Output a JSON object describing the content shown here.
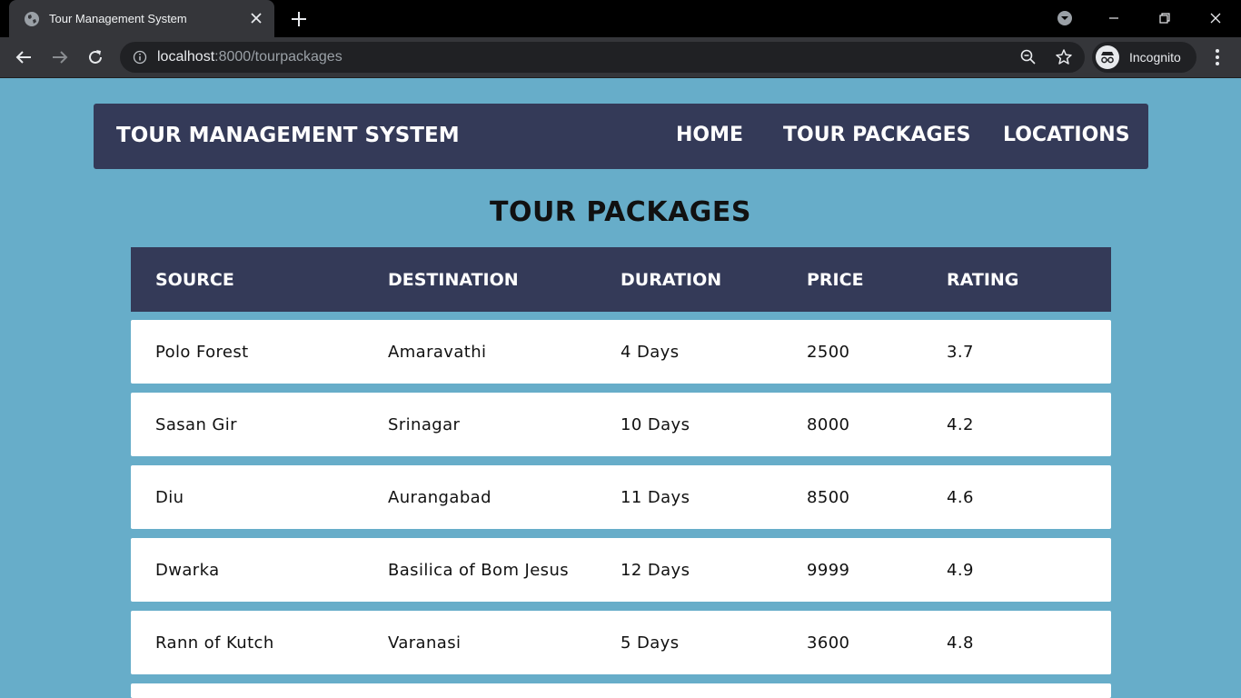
{
  "browser": {
    "tab_title": "Tour Management System",
    "url_host": "localhost",
    "url_rest": ":8000/tourpackages",
    "profile_label": "Incognito"
  },
  "nav": {
    "brand": "TOUR MANAGEMENT SYSTEM",
    "links": [
      "HOME",
      "TOUR PACKAGES",
      "LOCATIONS"
    ]
  },
  "page": {
    "title": "TOUR PACKAGES"
  },
  "table": {
    "headers": [
      "SOURCE",
      "DESTINATION",
      "DURATION",
      "PRICE",
      "RATING"
    ],
    "rows": [
      [
        "Polo Forest",
        "Amaravathi",
        "4 Days",
        "2500",
        "3.7"
      ],
      [
        "Sasan Gir",
        "Srinagar",
        "10 Days",
        "8000",
        "4.2"
      ],
      [
        "Diu",
        "Aurangabad",
        "11 Days",
        "8500",
        "4.6"
      ],
      [
        "Dwarka",
        "Basilica of Bom Jesus",
        "12 Days",
        "9999",
        "4.9"
      ],
      [
        "Rann of Kutch",
        "Varanasi",
        "5 Days",
        "3600",
        "4.8"
      ],
      [
        "",
        "",
        "",
        "",
        ""
      ]
    ]
  },
  "colors": {
    "page_bg": "#67adc9",
    "navbar_bg": "#343a58",
    "row_bg": "#ffffff"
  }
}
